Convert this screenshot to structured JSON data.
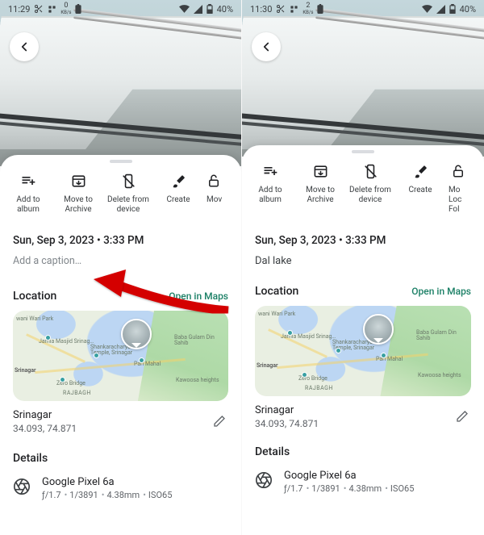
{
  "left": {
    "status": {
      "time": "11:29",
      "net_label": "0",
      "net_unit": "KB/s",
      "battery": "40%"
    },
    "date_line": "Sun, Sep 3, 2023  •  3:33 PM",
    "caption_placeholder": "Add a caption…",
    "actions": [
      {
        "label": "Add to album",
        "icon": "playlist-add-icon"
      },
      {
        "label": "Move to Archive",
        "icon": "archive-icon"
      },
      {
        "label": "Delete from device",
        "icon": "no-mobile-icon"
      },
      {
        "label": "Create",
        "icon": "brush-icon"
      },
      {
        "label": "Mov",
        "icon": "lock-icon"
      }
    ],
    "location": {
      "title": "Location",
      "open_label": "Open in Maps",
      "city": "Srinagar",
      "coords": "34.093, 74.871",
      "map_labels": [
        "wani Wari Park",
        "Jamia Masjid Srinag…",
        "Shankaracharya Temple, Srinagar",
        "Pari Mahal",
        "Baba Gulam Din Sahib",
        "Srinagar",
        "Zero Bridge",
        "RAJBAGH",
        "Kawoosa heights"
      ]
    },
    "details": {
      "title": "Details",
      "device": "Google Pixel 6a",
      "meta": [
        "ƒ/1.7",
        "1/3891",
        "4.38mm",
        "ISO65"
      ]
    }
  },
  "right": {
    "status": {
      "time": "11:30",
      "net_label": "2",
      "net_unit": "KB/s",
      "battery": "40%"
    },
    "date_line": "Sun, Sep 3, 2023  •  3:33 PM",
    "caption_text": "Dal lake",
    "actions": [
      {
        "label": "Add to album",
        "icon": "playlist-add-icon"
      },
      {
        "label": "Move to Archive",
        "icon": "archive-icon"
      },
      {
        "label": "Delete from device",
        "icon": "no-mobile-icon"
      },
      {
        "label": "Create",
        "icon": "brush-icon"
      },
      {
        "label": "Mo\nLoc\nFol",
        "icon": "lock-icon"
      }
    ],
    "location": {
      "title": "Location",
      "open_label": "Open in Maps",
      "city": "Srinagar",
      "coords": "34.093, 74.871",
      "map_labels": [
        "wani Wari Park",
        "Jamia Masjid Srinag…",
        "Shankaracharya Temple, Srinagar",
        "Pari Mahal",
        "Baba Gulam Din Sahib",
        "Srinagar",
        "Zero Bridge",
        "RAJBAGH",
        "Kawoosa heights"
      ]
    },
    "details": {
      "title": "Details",
      "device": "Google Pixel 6a",
      "meta": [
        "ƒ/1.7",
        "1/3891",
        "4.38mm",
        "ISO65"
      ]
    }
  }
}
